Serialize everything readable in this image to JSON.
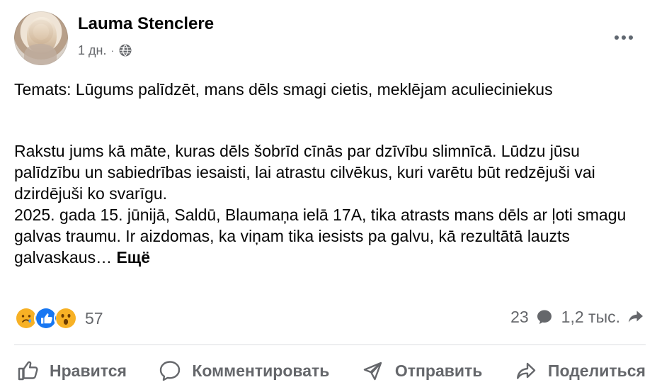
{
  "post": {
    "author": "Lauma Stenclere",
    "time": "1 дн.",
    "meta_separator": "·",
    "privacy_icon": "globe-icon",
    "more_icon": "more-icon",
    "title": "Temats: Lūgums palīdzēt, mans dēls smagi cietis, meklējam aculieciniekus",
    "body_lines": [
      "Rakstu jums kā māte, kuras dēls šobrīd cīnās par dzīvību slimnīcā. Lūdzu jūsu palīdzību un sabiedrības iesaisti, lai atrastu cilvēkus, kuri varētu būt redzējuši vai dzirdējuši ko svarīgu.",
      "2025. gada 15. jūnijā, Saldū, Blaumaņa ielā 17A, tika atrasts mans dēls ar ļoti smagu galvas traumu. Ir aizdomas, ka viņam tika iesists pa galvu, kā rezultātā lauzts galvaskaus…"
    ],
    "see_more": "Ещё"
  },
  "stats": {
    "reaction_icons": [
      "sad-reaction-icon",
      "like-reaction-icon",
      "wow-reaction-icon"
    ],
    "reaction_count": "57",
    "comments_count": "23",
    "comments_icon": "comment-bubble-icon",
    "shares_count": "1,2 тыс.",
    "shares_icon": "share-arrow-icon"
  },
  "actions": {
    "like_label": "Нравится",
    "like_icon": "like-icon",
    "comment_label": "Комментировать",
    "comment_icon": "comment-icon",
    "send_label": "Отправить",
    "send_icon": "send-icon",
    "share_label": "Поделиться",
    "share_icon": "share-icon"
  },
  "colors": {
    "text_primary": "#050505",
    "text_secondary": "#65676b",
    "divider": "#dadde1",
    "like_blue": "#1877f2",
    "reaction_yellow": "#f7b125"
  }
}
